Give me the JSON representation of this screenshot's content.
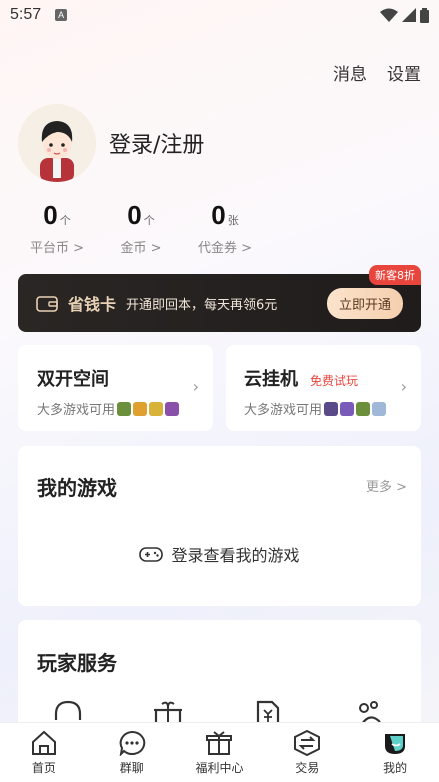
{
  "status": {
    "time": "5:57",
    "app_badge": "A"
  },
  "topbar": {
    "messages": "消息",
    "settings": "设置"
  },
  "profile": {
    "login": "登录/注册"
  },
  "stats": [
    {
      "value": "0",
      "unit": "个",
      "label": "平台币 >"
    },
    {
      "value": "0",
      "unit": "个",
      "label": "金币 >"
    },
    {
      "value": "0",
      "unit": "张",
      "label": "代金券 >"
    }
  ],
  "vip": {
    "title": "省钱卡",
    "desc": "开通即回本，每天再领6元",
    "button": "立即开通",
    "badge": "新客8折"
  },
  "features": [
    {
      "title": "双开空间",
      "tag": "",
      "sub": "大多游戏可用"
    },
    {
      "title": "云挂机",
      "tag": "免费试玩",
      "sub": "大多游戏可用"
    }
  ],
  "my_games": {
    "title": "我的游戏",
    "more": "更多 >",
    "login_prompt": "登录查看我的游戏"
  },
  "services": {
    "title": "玩家服务"
  },
  "nav": [
    {
      "label": "首页"
    },
    {
      "label": "群聊"
    },
    {
      "label": "福利中心"
    },
    {
      "label": "交易"
    },
    {
      "label": "我的"
    }
  ],
  "colors": {
    "accent_red": "#e8463d",
    "vip_bg": "#1f1c1b",
    "vip_gold": "#e8d2b6"
  }
}
